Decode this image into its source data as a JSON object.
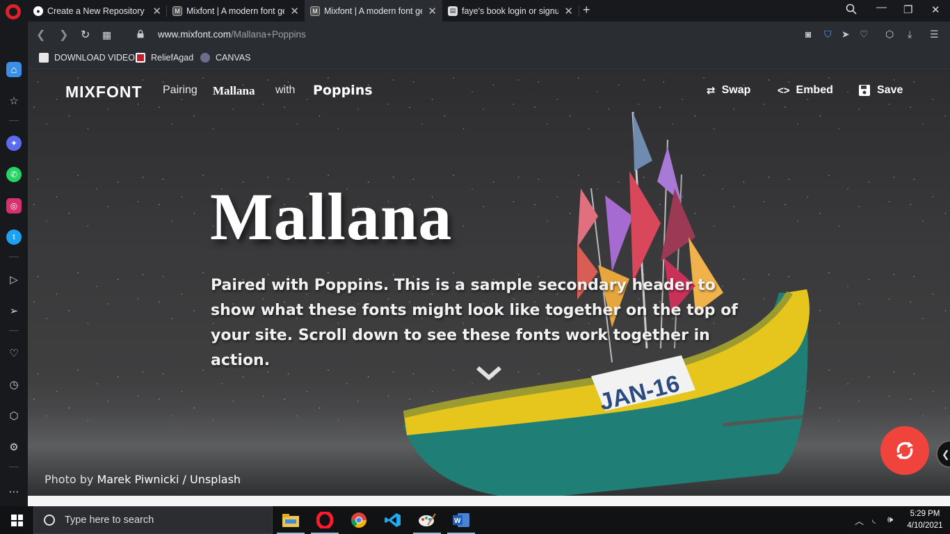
{
  "browser": {
    "tabs": [
      {
        "title": "Create a New Repository",
        "icon": "github-icon"
      },
      {
        "title": "Mixfont | A modern font ge",
        "icon": "mixfont-icon"
      },
      {
        "title": "Mixfont | A modern font ge",
        "icon": "mixfont-icon",
        "active": true
      },
      {
        "title": "faye's book login or signup",
        "icon": "document-icon"
      }
    ],
    "url_host": "www.mixfont.com",
    "url_path": "/Mallana+Poppins",
    "bookmarks": [
      "DOWNLOAD VIDEO",
      "ReliefAgad",
      "CANVAS"
    ]
  },
  "site": {
    "logo": "MIXFONT",
    "pairing_label": "Pairing",
    "font1": "Mallana",
    "with_label": "with",
    "font2": "Poppins",
    "actions": {
      "swap": "Swap",
      "embed": "Embed",
      "save": "Save"
    },
    "headline": "Mallana",
    "subhead": "Paired with Poppins. This is a sample secondary header to show what these fonts might look like together on the top of your site. Scroll down to see these fonts work together in action.",
    "credit_prefix": "Photo by",
    "credit_author": "Marek Piwnicki",
    "credit_sep": "/",
    "credit_source": "Unsplash",
    "boat_label": "JAN-16"
  },
  "taskbar": {
    "search_placeholder": "Type here to search",
    "time": "5:29 PM",
    "date": "4/10/2021"
  },
  "colors": {
    "fab": "#f0433c",
    "opera_red": "#e0202a"
  }
}
